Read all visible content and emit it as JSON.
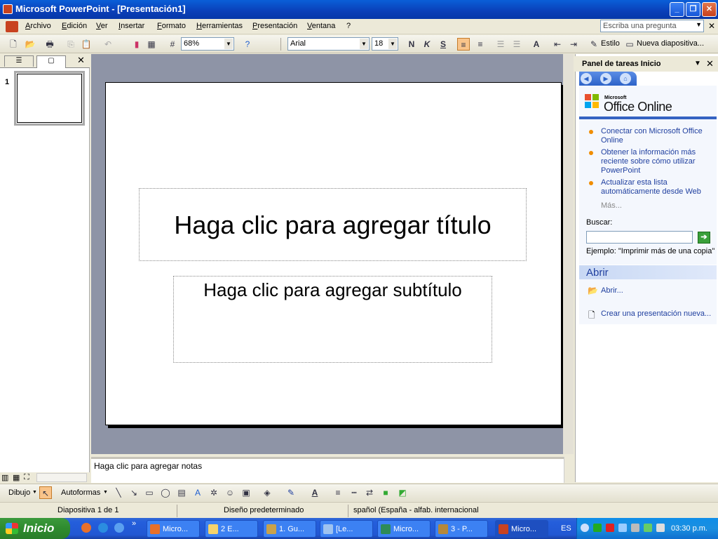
{
  "window": {
    "title": "Microsoft PowerPoint - [Presentación1]"
  },
  "menu": {
    "items": [
      "Archivo",
      "Edición",
      "Ver",
      "Insertar",
      "Formato",
      "Herramientas",
      "Presentación",
      "Ventana",
      "?"
    ],
    "ask_placeholder": "Escriba una pregunta"
  },
  "toolbar": {
    "zoom": "68%",
    "font": "Arial",
    "font_size": "18",
    "bold_label": "N",
    "italic_label": "K",
    "shadow_label": "S",
    "style_label": "Estilo",
    "new_slide_label": "Nueva diapositiva..."
  },
  "slides_panel": {
    "slide_number": "1"
  },
  "slide": {
    "title_placeholder": "Haga clic para agregar título",
    "subtitle_placeholder": "Haga clic para agregar subtítulo"
  },
  "notes": {
    "placeholder": "Haga clic para agregar notas"
  },
  "task_pane": {
    "title": "Panel de tareas Inicio",
    "logo_small": "Microsoft",
    "logo_text": "Office Online",
    "links": [
      "Conectar con Microsoft Office Online",
      "Obtener la información más reciente sobre cómo utilizar PowerPoint",
      "Actualizar esta lista automáticamente desde Web"
    ],
    "more": "Más...",
    "search_label": "Buscar:",
    "example": "Ejemplo:  \"Imprimir más de una copia\"",
    "open_section": "Abrir",
    "open_link": "Abrir...",
    "new_link": "Crear una presentación nueva..."
  },
  "drawing_toolbar": {
    "draw_label": "Dibujo",
    "autoshapes_label": "Autoformas"
  },
  "status": {
    "slide": "Diapositiva 1 de 1",
    "design": "Diseño predeterminado",
    "language": "spañol (España - alfab. internacional"
  },
  "taskbar": {
    "start_label": "Inicio",
    "tasks": [
      "Micro...",
      "2 E...",
      "1. Gu...",
      "[Le...",
      "Micro...",
      "3 - P...",
      "Micro..."
    ],
    "language": "ES",
    "clock": "03:30 p.m."
  },
  "colors": {
    "accent": "#0a5fd8",
    "slide_bg": "#8e94a6",
    "link": "#1f3f9f",
    "bullet": "#f08d00"
  }
}
